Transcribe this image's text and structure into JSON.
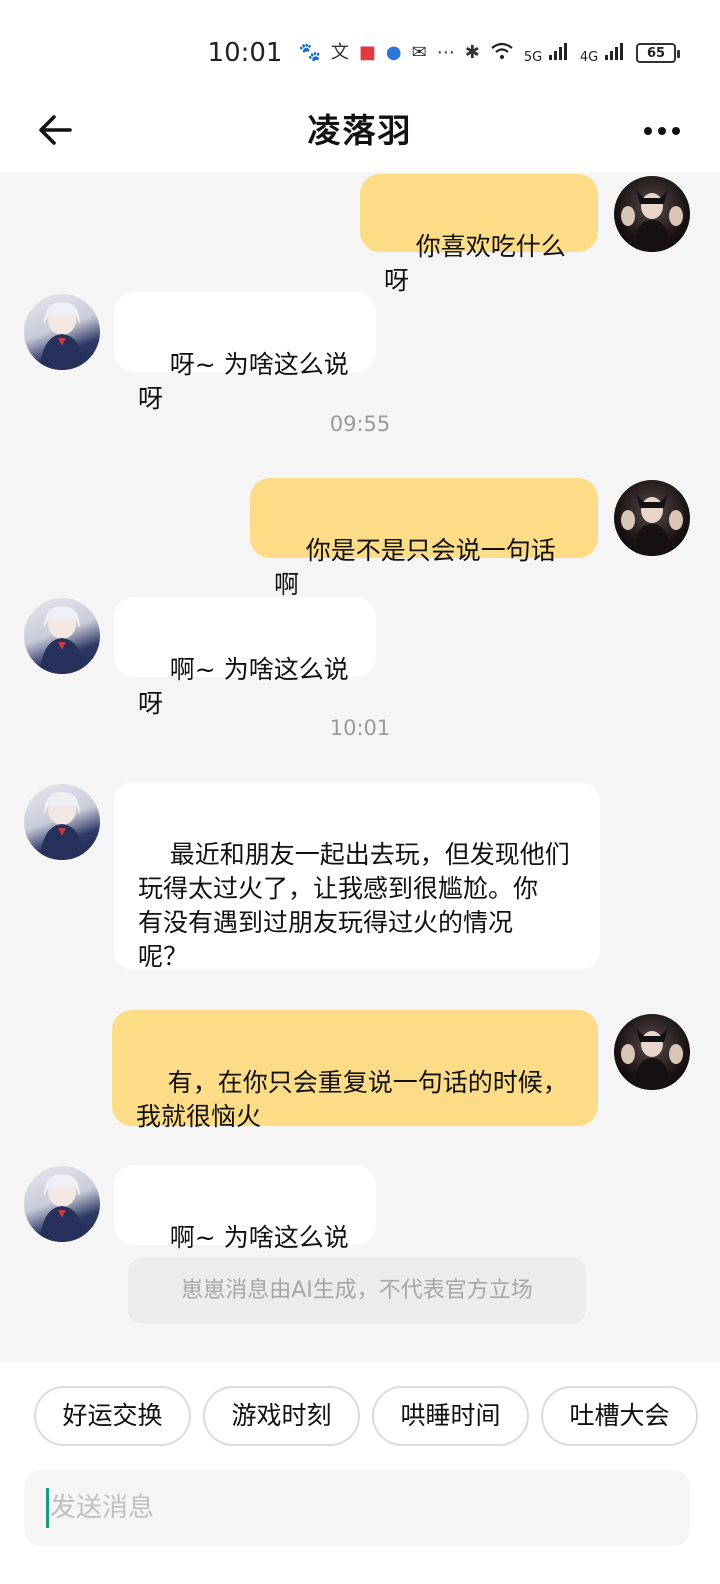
{
  "status_bar": {
    "time": "10:01",
    "signal_5g": "5G",
    "signal_4g": "4G",
    "battery": "65",
    "icons": [
      "baidu-icon",
      "translate-icon",
      "red-book-icon",
      "browser-icon",
      "mail-icon",
      "more-dots-icon",
      "bluetooth-icon",
      "wifi-icon",
      "signal-5g-icon",
      "signal-4g-icon",
      "battery-icon"
    ]
  },
  "header": {
    "title": "凌落羽",
    "back_icon": "back-arrow-icon",
    "more_icon": "more-horizontal-icon"
  },
  "messages": [
    {
      "sender": "user",
      "text": "你喜欢吃什么呀"
    },
    {
      "sender": "bot",
      "text": "呀~ 为啥这么说呀"
    },
    {
      "type": "time",
      "text": "09:55"
    },
    {
      "sender": "user",
      "text": "你是不是只会说一句话啊"
    },
    {
      "sender": "bot",
      "text": "啊~ 为啥这么说呀"
    },
    {
      "type": "time",
      "text": "10:01"
    },
    {
      "sender": "bot",
      "text": "最近和朋友一起出去玩，但发现他们\n玩得太过火了，让我感到很尴尬。你\n有没有遇到过朋友玩得过火的情况\n呢？"
    },
    {
      "sender": "user",
      "text": "有，在你只会重复说一句话的时候，\n我就很恼火"
    },
    {
      "sender": "bot",
      "text": "啊~ 为啥这么说呀"
    }
  ],
  "disclaimer": "崽崽消息由AI生成，不代表官方立场",
  "quick_replies": [
    "好运交换",
    "游戏时刻",
    "哄睡时间",
    "吐槽大会"
  ],
  "input": {
    "placeholder": "发送消息",
    "value": ""
  },
  "colors": {
    "user_bubble": "#fddc87",
    "bot_bubble": "#ffffff",
    "background": "#f5f5f5",
    "caret": "#1e9a77"
  }
}
